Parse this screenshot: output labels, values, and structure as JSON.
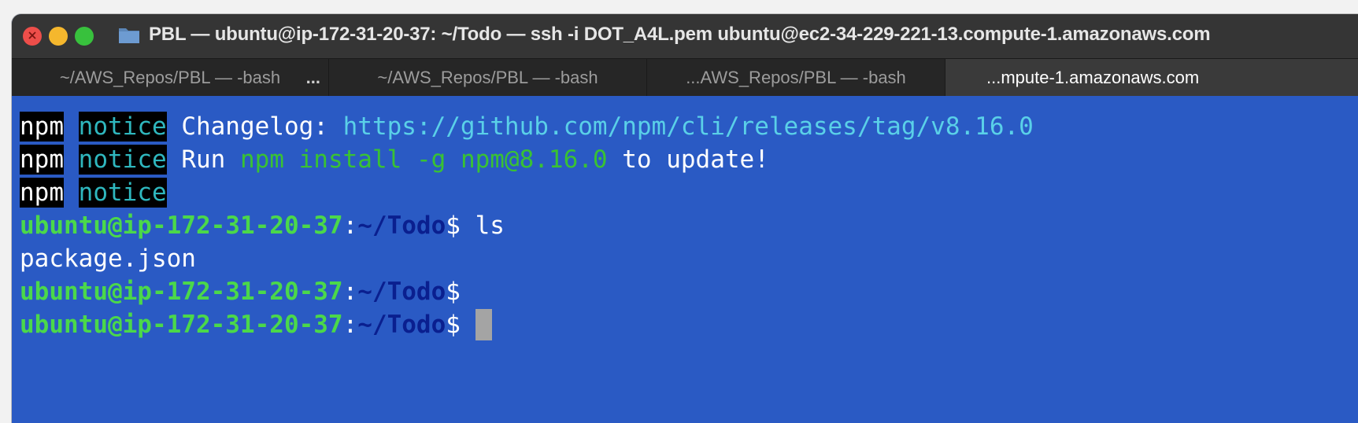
{
  "window": {
    "title": "PBL — ubuntu@ip-172-31-20-37: ~/Todo — ssh -i DOT_A4L.pem ubuntu@ec2-34-229-221-13.compute-1.amazonaws.com",
    "tabs": [
      {
        "label": "~/AWS_Repos/PBL — -bash",
        "more": "..."
      },
      {
        "label": "~/AWS_Repos/PBL — -bash"
      },
      {
        "label": "...AWS_Repos/PBL — -bash"
      },
      {
        "label": "...mpute-1.amazonaws.com",
        "active": true
      }
    ]
  },
  "terminal": {
    "line1": {
      "a": "npm",
      "b": "notice",
      "c": " Changelog: ",
      "d": "https://github.com/npm/cli/releases/tag/v8.16.0"
    },
    "line2": {
      "a": "npm",
      "b": "notice",
      "c": " Run ",
      "d": "npm install -g npm@8.16.0",
      "e": " to update!"
    },
    "line3": {
      "a": "npm",
      "b": "notice"
    },
    "prompt_user": "ubuntu@ip-172-31-20-37",
    "prompt_sep": ":",
    "prompt_path": "~/Todo",
    "prompt_dollar": "$",
    "cmd1": " ls",
    "output1": "package.json"
  },
  "colors": {
    "terminal_bg": "#2a5ac4",
    "prompt_user": "#4bd84a",
    "prompt_path": "#0a1f8f",
    "notice": "#2fb7be",
    "url": "#5ad0e8"
  }
}
